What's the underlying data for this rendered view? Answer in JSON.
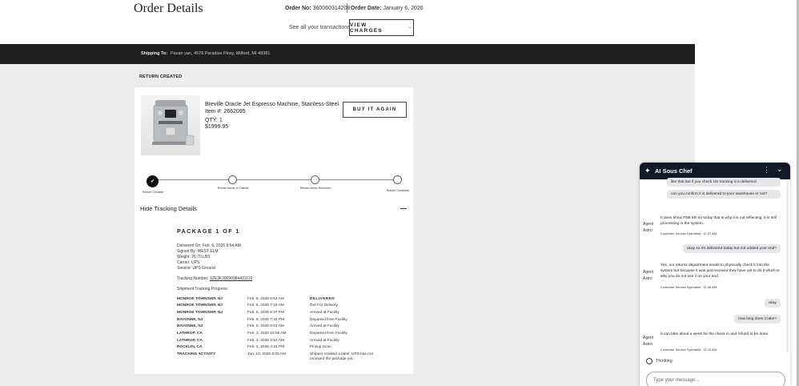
{
  "header": {
    "title": "Order Details",
    "order_no_label": "Order No:",
    "order_no": "360060314208",
    "order_date_label": "Order Date:",
    "order_date": "January 6, 2026",
    "see_all": "See all your transactions",
    "view_charges": "VIEW CHARGES",
    "arrow": "→"
  },
  "shipping": {
    "label": "Shipping To:",
    "address": "Pavan yan, 4576 Paradise Pkwy, Milford, MI 48381"
  },
  "return_status": "RETURN CREATED",
  "product": {
    "name": "Breville Oracle Jet Espresso Machine, Stainless-Steel",
    "item_no": "Item #: 2662095",
    "qty": "QTY: 1",
    "price": "$1999.95",
    "buy_again": "BUY IT AGAIN"
  },
  "progress_steps": [
    {
      "label": "Return Created",
      "done": true
    },
    {
      "label": "Return Items In Transit",
      "done": false
    },
    {
      "label": "Return Items Received",
      "done": false
    },
    {
      "label": "Return Complete",
      "done": false
    }
  ],
  "tracking": {
    "toggle_label": "Hide Tracking Details",
    "package_title": "PACKAGE 1 OF 1",
    "delivered_on": "Delivered On: Feb. 6, 2026 9:54 AM",
    "signed_by": "Signed By: WEST ELM",
    "weight": "Weight: 26.70 LBS",
    "carrier": "Carrier: UPS",
    "service": "Service: UPS Ground",
    "number_label": "Tracking Number:",
    "number": "1ZE3F30090984431119",
    "progress_label": "Shipment Tracking Progress:",
    "events": [
      {
        "loc": "MONROE TOWNSHIP, NJ",
        "time": "Feb. 6, 2026 9:54 AM",
        "desc": "DELIVERED"
      },
      {
        "loc": "MONROE TOWNSHIP, NJ",
        "time": "Feb. 6, 2026 7:18 AM",
        "desc": "Out For Delivery"
      },
      {
        "loc": "MONROE TOWNSHIP, NJ",
        "time": "Feb. 5, 2026 8:37 PM",
        "desc": "Arrived at Facility"
      },
      {
        "loc": "BAYONNE, NJ",
        "time": "Feb. 5, 2026 7:44 PM",
        "desc": "Departed from Facility"
      },
      {
        "loc": "BAYONNE, NJ",
        "time": "Feb. 5, 2026 9:01 AM",
        "desc": "Arrived at Facility"
      },
      {
        "loc": "LATHROP, CA",
        "time": "Feb. 3, 2026 10:58 AM",
        "desc": "Departed from Facility"
      },
      {
        "loc": "LATHROP, CA",
        "time": "Feb. 3, 2026 3:53 AM",
        "desc": "Arrived at Facility"
      },
      {
        "loc": "ROCKLIN, CA",
        "time": "Feb. 2, 2026 4:31 PM",
        "desc": "Pickup Scan"
      },
      {
        "loc": "Tracking Activity",
        "time": "Jan. 10, 2026 9:05 AM",
        "desc": "Shipper created a label, UPS has not received the package yet."
      }
    ]
  },
  "chat": {
    "title": "AI Sous Chef",
    "messages": [
      {
        "type": "user",
        "text": "like that but if you check US tracking it is delivered"
      },
      {
        "type": "user",
        "text": "can you confirm it is delivered to your warehouse or not?"
      },
      {
        "type": "agent",
        "text": "It does show FEB 6th so today that is why it is not reflecting, It is still processing in the system..",
        "meta": "Customer Service Specialist · 11:07 AM"
      },
      {
        "type": "user",
        "text": "okay so it's delivered today but not udated your end?"
      },
      {
        "type": "agent",
        "text": "Yes, our returns department needs to physically check it into the system but because it was just received they have yet to do it which is why you do not see it on your end.",
        "meta": "Customer Service Specialist · 11:08 AM"
      },
      {
        "type": "user",
        "text": "okay"
      },
      {
        "type": "user",
        "text": "how long does it take?"
      },
      {
        "type": "agent",
        "text": "It can take about a week for the check in and refund to be done.",
        "meta": "Customer Service Specialist · 11:10 AM"
      }
    ],
    "agent_label": "Agent Astro",
    "thinking": "Thinking",
    "input_placeholder": "Type your message..."
  }
}
